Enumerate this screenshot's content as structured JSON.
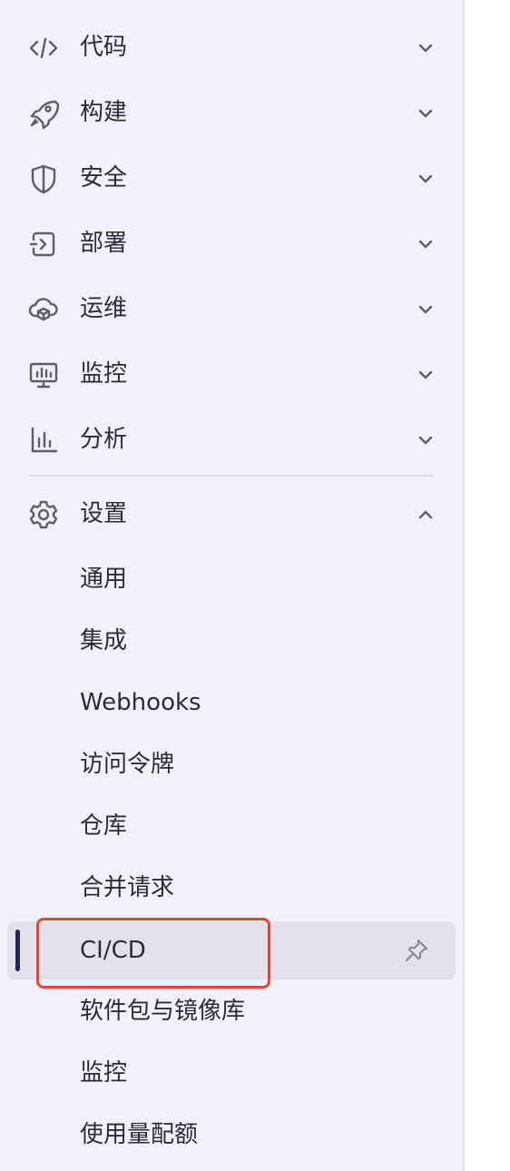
{
  "nav": {
    "items": [
      {
        "label": "代码",
        "icon": "code-icon",
        "expanded": false
      },
      {
        "label": "构建",
        "icon": "rocket-icon",
        "expanded": false
      },
      {
        "label": "安全",
        "icon": "shield-icon",
        "expanded": false
      },
      {
        "label": "部署",
        "icon": "deploy-icon",
        "expanded": false
      },
      {
        "label": "运维",
        "icon": "cloud-box-icon",
        "expanded": false
      },
      {
        "label": "监控",
        "icon": "monitor-icon",
        "expanded": false
      },
      {
        "label": "分析",
        "icon": "bar-chart-icon",
        "expanded": false
      },
      {
        "label": "设置",
        "icon": "gear-icon",
        "expanded": true
      }
    ]
  },
  "settings": {
    "subitems": [
      {
        "label": "通用"
      },
      {
        "label": "集成"
      },
      {
        "label": "Webhooks"
      },
      {
        "label": "访问令牌"
      },
      {
        "label": "仓库"
      },
      {
        "label": "合并请求"
      },
      {
        "label": "CI/CD",
        "active": true,
        "pin_icon": "pin-icon"
      },
      {
        "label": "软件包与镜像库"
      },
      {
        "label": "监控"
      },
      {
        "label": "使用量配额"
      }
    ]
  },
  "colors": {
    "sidebar_bg": "#f1f0fb",
    "active_bg": "#e3e2ec",
    "active_indicator": "#24245e",
    "highlight": "#e8452f",
    "icon": "#5e5d6b"
  }
}
